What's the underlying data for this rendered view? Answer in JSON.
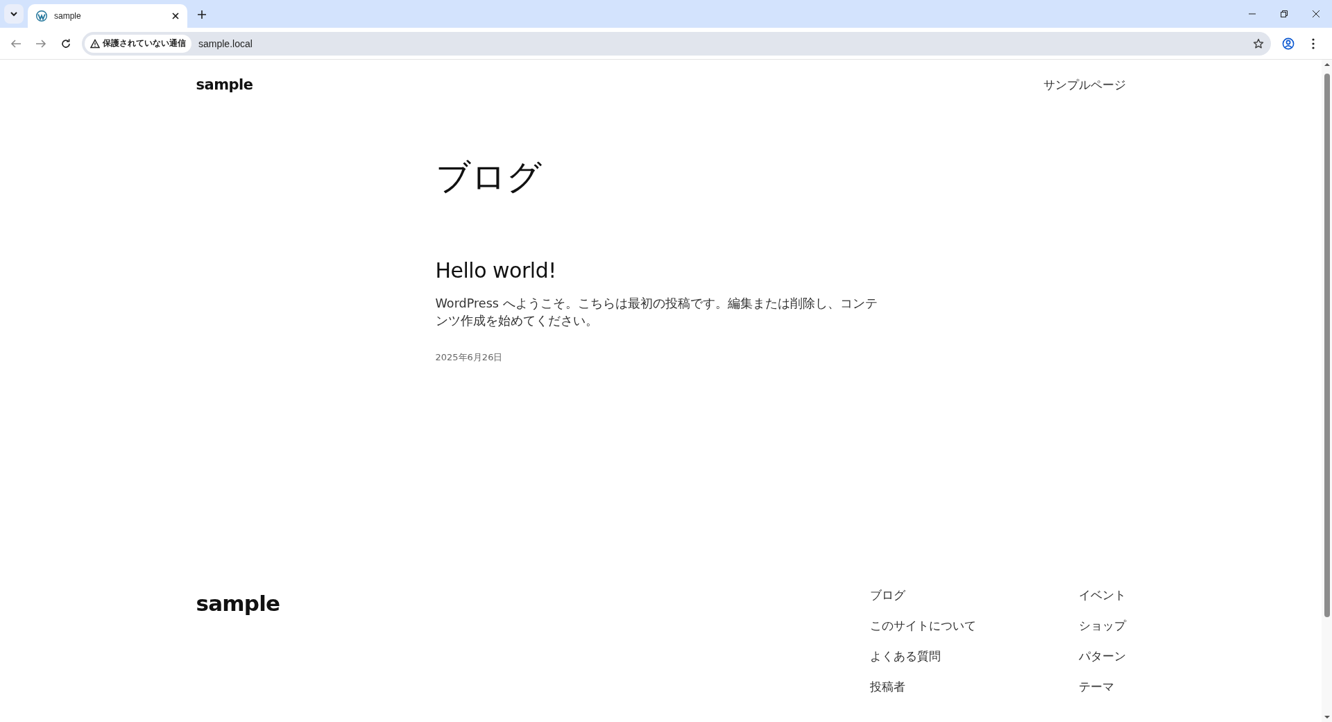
{
  "browser": {
    "tab": {
      "title": "sample",
      "selected": true
    },
    "address_bar": {
      "security_label": "保護されていない通信",
      "url": "sample.local"
    }
  },
  "header": {
    "site_title": "sample",
    "nav": [
      "サンプルページ"
    ]
  },
  "main": {
    "page_title": "ブログ",
    "posts": [
      {
        "title": "Hello world!",
        "excerpt": "WordPress へようこそ。こちらは最初の投稿です。編集または削除し、コンテンツ作成を始めてください。",
        "date": "2025年6月26日"
      }
    ]
  },
  "footer": {
    "site_title": "sample",
    "nav_columns": [
      [
        "ブログ",
        "このサイトについて",
        "よくある質問",
        "投稿者"
      ],
      [
        "イベント",
        "ショップ",
        "パターン",
        "テーマ"
      ]
    ]
  }
}
